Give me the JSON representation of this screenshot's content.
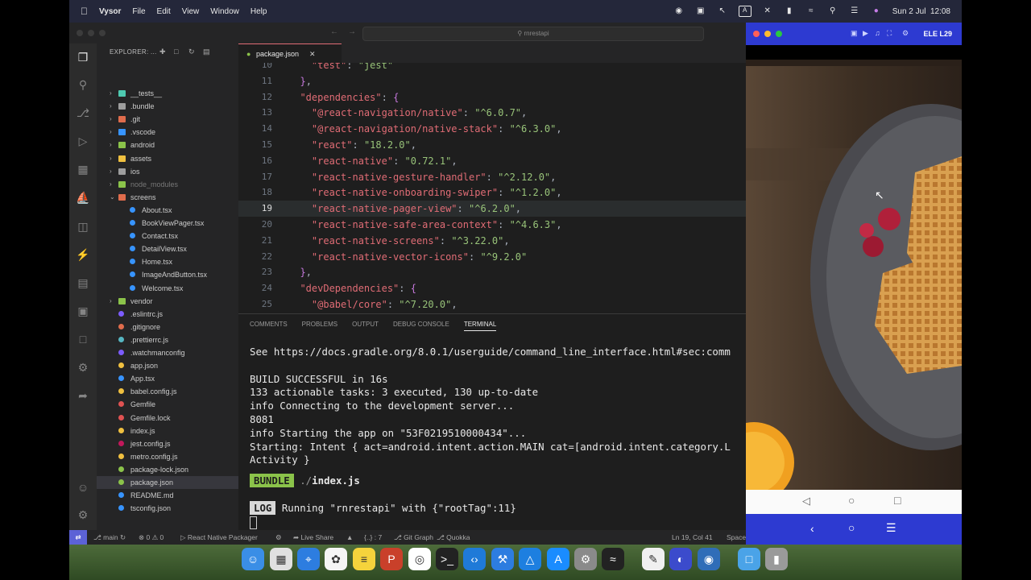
{
  "menubar": {
    "app_name": "Vysor",
    "items": [
      "File",
      "Edit",
      "View",
      "Window",
      "Help"
    ],
    "clock": "Sun 2 Jul  12:08",
    "status_icons": [
      "record-icon",
      "screenshot-icon",
      "cursor-icon",
      "keyboard-input-icon",
      "pen-icon",
      "battery-icon",
      "wifi-icon",
      "spotlight-icon",
      "control-center-icon",
      "siri-icon"
    ],
    "keyboard_label": "A"
  },
  "vscode": {
    "window_title": "rnrestapi",
    "explorer_label": "EXPLORER: ...",
    "tab_label": "package.json",
    "file_tree": [
      {
        "name": "__tests__",
        "type": "folder",
        "color": "#4ec9b0"
      },
      {
        "name": ".bundle",
        "type": "folder",
        "color": "#9e9e9e"
      },
      {
        "name": ".git",
        "type": "folder",
        "color": "#e06c4c"
      },
      {
        "name": ".vscode",
        "type": "folder",
        "color": "#3794ff"
      },
      {
        "name": "android",
        "type": "folder",
        "color": "#8bc34a"
      },
      {
        "name": "assets",
        "type": "folder",
        "color": "#f0c040"
      },
      {
        "name": "ios",
        "type": "folder",
        "color": "#9e9e9e"
      },
      {
        "name": "node_modules",
        "type": "folder",
        "color": "#8bc34a",
        "dim": true
      },
      {
        "name": "screens",
        "type": "folder-open",
        "color": "#e06c4c"
      },
      {
        "name": "About.tsx",
        "type": "tsx",
        "color": "#3794ff",
        "indent": true
      },
      {
        "name": "BookViewPager.tsx",
        "type": "tsx",
        "color": "#3794ff",
        "indent": true
      },
      {
        "name": "Contact.tsx",
        "type": "tsx",
        "color": "#3794ff",
        "indent": true
      },
      {
        "name": "DetailView.tsx",
        "type": "tsx",
        "color": "#3794ff",
        "indent": true
      },
      {
        "name": "Home.tsx",
        "type": "tsx",
        "color": "#3794ff",
        "indent": true
      },
      {
        "name": "ImageAndButton.tsx",
        "type": "tsx",
        "color": "#3794ff",
        "indent": true
      },
      {
        "name": "Welcome.tsx",
        "type": "tsx",
        "color": "#3794ff",
        "indent": true
      },
      {
        "name": "vendor",
        "type": "folder",
        "color": "#8bc34a"
      },
      {
        "name": ".eslintrc.js",
        "type": "file",
        "color": "#7c5cff"
      },
      {
        "name": ".gitignore",
        "type": "file",
        "color": "#e06c4c"
      },
      {
        "name": ".prettierrc.js",
        "type": "file",
        "color": "#56b6c2"
      },
      {
        "name": ".watchmanconfig",
        "type": "file",
        "color": "#7c5cff"
      },
      {
        "name": "app.json",
        "type": "file",
        "color": "#f0c040"
      },
      {
        "name": "App.tsx",
        "type": "file",
        "color": "#3794ff"
      },
      {
        "name": "babel.config.js",
        "type": "file",
        "color": "#f0c040"
      },
      {
        "name": "Gemfile",
        "type": "file",
        "color": "#e05252"
      },
      {
        "name": "Gemfile.lock",
        "type": "file",
        "color": "#e05252"
      },
      {
        "name": "index.js",
        "type": "file",
        "color": "#f0c040"
      },
      {
        "name": "jest.config.js",
        "type": "file",
        "color": "#c2185b"
      },
      {
        "name": "metro.config.js",
        "type": "file",
        "color": "#f0c040"
      },
      {
        "name": "package-lock.json",
        "type": "file",
        "color": "#8bc34a"
      },
      {
        "name": "package.json",
        "type": "file",
        "color": "#8bc34a",
        "selected": true
      },
      {
        "name": "README.md",
        "type": "file",
        "color": "#3794ff"
      },
      {
        "name": "tsconfig.json",
        "type": "file",
        "color": "#3794ff"
      }
    ],
    "code_lines": [
      {
        "n": "10",
        "text": "    \"test\": \"jest\""
      },
      {
        "n": "11",
        "text": "  },"
      },
      {
        "n": "12",
        "text": "  \"dependencies\": {"
      },
      {
        "n": "13",
        "text": "    \"@react-navigation/native\": \"^6.0.7\","
      },
      {
        "n": "14",
        "text": "    \"@react-navigation/native-stack\": \"^6.3.0\","
      },
      {
        "n": "15",
        "text": "    \"react\": \"18.2.0\","
      },
      {
        "n": "16",
        "text": "    \"react-native\": \"0.72.1\","
      },
      {
        "n": "17",
        "text": "    \"react-native-gesture-handler\": \"^2.12.0\","
      },
      {
        "n": "18",
        "text": "    \"react-native-onboarding-swiper\": \"^1.2.0\","
      },
      {
        "n": "19",
        "text": "    \"react-native-pager-view\": \"^6.2.0\",",
        "current": true
      },
      {
        "n": "20",
        "text": "    \"react-native-safe-area-context\": \"^4.6.3\","
      },
      {
        "n": "21",
        "text": "    \"react-native-screens\": \"^3.22.0\","
      },
      {
        "n": "22",
        "text": "    \"react-native-vector-icons\": \"^9.2.0\""
      },
      {
        "n": "23",
        "text": "  },"
      },
      {
        "n": "24",
        "text": "  \"devDependencies\": {"
      },
      {
        "n": "25",
        "text": "    \"@babel/core\": \"^7.20.0\","
      }
    ],
    "panel_tabs": [
      "COMMENTS",
      "PROBLEMS",
      "OUTPUT",
      "DEBUG CONSOLE",
      "TERMINAL"
    ],
    "active_panel_tab": "TERMINAL",
    "terminal_lines": [
      "See https://docs.gradle.org/8.0.1/userguide/command_line_interface.html#sec:comm",
      "",
      "BUILD SUCCESSFUL in 16s",
      "133 actionable tasks: 3 executed, 130 up-to-date",
      "info Connecting to the development server...",
      "8081",
      "info Starting the app on \"53F0219510000434\"...",
      "Starting: Intent { act=android.intent.action.MAIN cat=[android.intent.category.L",
      "Activity }"
    ],
    "bundle_badge": "BUNDLE",
    "bundle_path": " ./",
    "bundle_file": "index.js",
    "log_badge": "LOG",
    "log_text": " Running \"rnrestapi\" with {\"rootTag\":11}",
    "status": {
      "branch": "main",
      "problems": "0 ⚠ 0",
      "packager": "React Native Packager",
      "live_share": "Live Share",
      "brackets": "{..} : 7",
      "git_graph": "Git Graph",
      "quokka": "Quokka",
      "cursor": "Ln 19, Col 41",
      "spaces": "Space"
    }
  },
  "phone": {
    "device_name": "ELE L29"
  },
  "dock": {
    "apps": [
      "finder-icon",
      "launchpad-icon",
      "safari-icon",
      "photos-icon",
      "notes-icon",
      "powerpoint-icon",
      "chrome-icon",
      "terminal-icon",
      "vscode-icon",
      "xcode-icon",
      "altstore-icon",
      "appstore-icon",
      "settings-icon",
      "activity-monitor-icon",
      "textedit-icon",
      "vysor-icon",
      "proxyman-icon",
      "folder-icon",
      "trash-icon"
    ]
  }
}
